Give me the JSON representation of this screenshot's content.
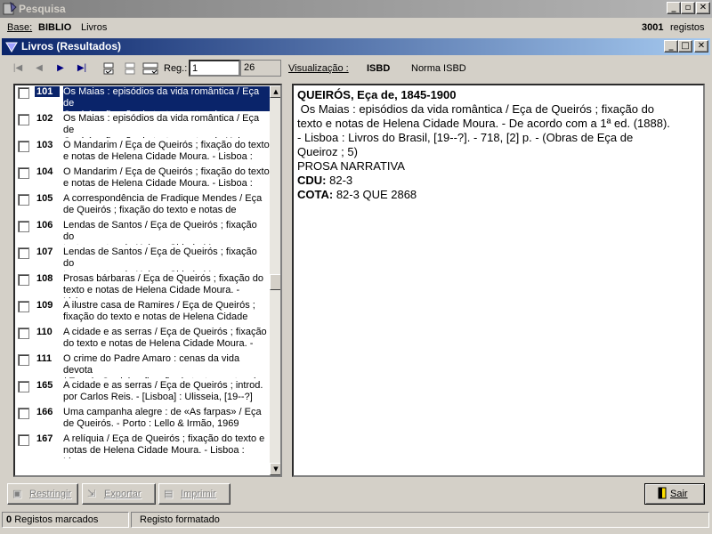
{
  "window": {
    "title": "Pesquisa"
  },
  "base": {
    "label": "Base:",
    "name": "BIBLIO",
    "type": "Livros",
    "count": "3001",
    "count_label": "registos"
  },
  "results_window": {
    "title": "Livros (Resultados)"
  },
  "toolbar": {
    "reg_label": "Reg.:",
    "reg_value": "1",
    "reg_total": "26",
    "view_label": "Visualização :",
    "view_format": "ISBD",
    "view_format_name": "Norma ISBD"
  },
  "records": [
    {
      "num": "101",
      "line1": "Os Maias : episódios da vida romântica / Eça de",
      "line2": "Queirós ; fixação do texto e notas de",
      "selected": true
    },
    {
      "num": "102",
      "line1": "Os Maias : episódios da vida romântica / Eça de",
      "line2": "Queirós ; fixação do texto e notas de Helena"
    },
    {
      "num": "103",
      "line1": "O Mandarim / Eça de Queirós ; fixação do texto",
      "line2": "e notas de Helena Cidade Moura. - Lisboa :"
    },
    {
      "num": "104",
      "line1": "O Mandarim / Eça de Queirós ; fixação do texto",
      "line2": "e notas de Helena Cidade Moura. - Lisboa :"
    },
    {
      "num": "105",
      "line1": "A correspondência de Fradique Mendes / Eça",
      "line2": "de Queirós ; fixação do texto e notas de"
    },
    {
      "num": "106",
      "line1": "Lendas de Santos / Eça de Queirós ; fixação do",
      "line2": "texto e notas de Helena Cidade Moura. - Lisboa"
    },
    {
      "num": "107",
      "line1": "Lendas de Santos / Eça de Queirós ; fixação do",
      "line2": "texto e notas de Helena Cidade Moura. - Lisboa"
    },
    {
      "num": "108",
      "line1": "Prosas bárbaras / Eça de Queirós ; fixação do",
      "line2": "texto e notas de Helena Cidade Moura. - Lisboa"
    },
    {
      "num": "109",
      "line1": "A ilustre casa de Ramires / Eça de Queirós ;",
      "line2": "fixação do texto e notas de Helena Cidade"
    },
    {
      "num": "110",
      "line1": "A cidade e as serras / Eça de Queirós ; fixação",
      "line2": "do texto e notas de Helena Cidade Moura. -"
    },
    {
      "num": "111",
      "line1": "O crime do Padre Amaro : cenas da vida devota",
      "line2": "/ Eça de Queirós ; fixação do texto e notas de"
    },
    {
      "num": "165",
      "line1": "A cidade e as serras / Eça de Queirós ; introd.",
      "line2": "por Carlos Reis. - [Lisboa] : Ulisseia, [19--?]"
    },
    {
      "num": "166",
      "line1": "Uma campanha alegre : de «As farpas» / Eça",
      "line2": "de Queirós. - Porto : Lello & Irmão, 1969"
    },
    {
      "num": "167",
      "line1": "A relíquia / Eça de Queirós ; fixação do texto e",
      "line2": "notas de Helena Cidade Moura. - Lisboa : Livros"
    }
  ],
  "detail": {
    "heading": "QUEIRÓS, Eça de, 1845-1900",
    "lines": [
      " Os Maias : episódios da vida romântica / Eça de Queirós ; fixação do",
      "texto e notas de Helena Cidade Moura. - De acordo com a 1ª ed. (1888).",
      "- Lisboa : Livros do Brasil, [19--?]. - 718, [2] p. - (Obras de Eça de",
      "Queiroz ; 5)",
      "PROSA NARRATIVA"
    ],
    "cdu_label": "CDU:",
    "cdu_value": "82-3",
    "cota_label": "COTA:",
    "cota_value": "82-3 QUE 2868"
  },
  "actions": {
    "restringir": "Restringir",
    "exportar": "Exportar",
    "imprimir": "Imprimir",
    "sair": "Sair"
  },
  "status": {
    "marked_count": "0",
    "marked_label": "Registos marcados",
    "format_label": "Registo formatado"
  }
}
